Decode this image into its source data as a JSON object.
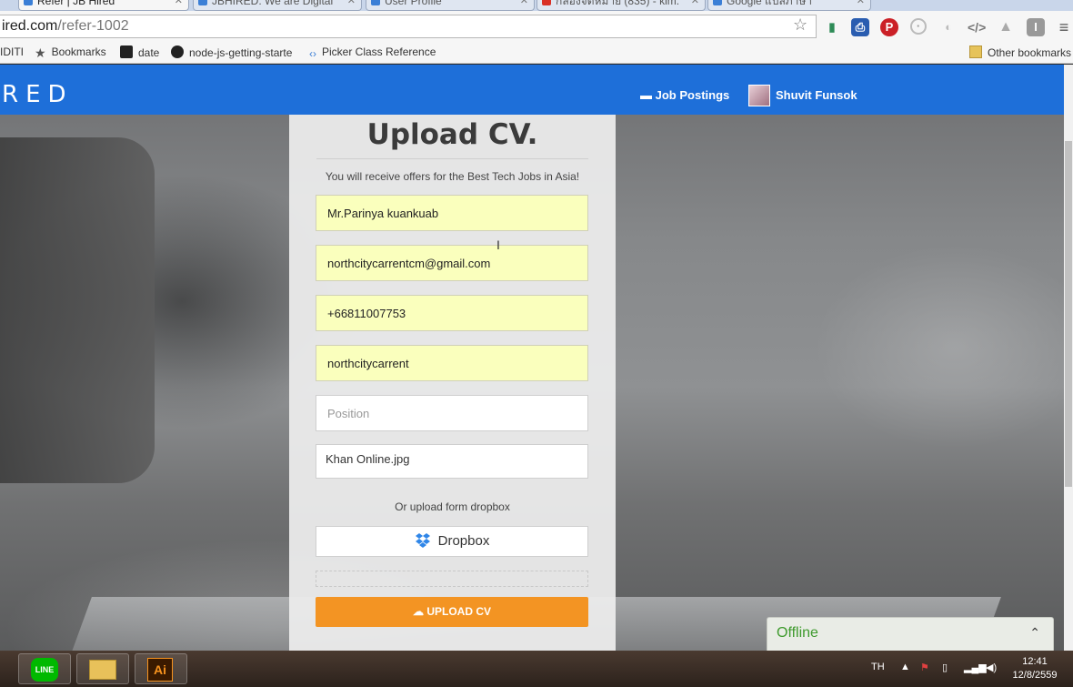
{
  "browser": {
    "tabs": [
      {
        "title": "Refer | JB Hired",
        "active": true
      },
      {
        "title": "JBHIRED: We are Digital",
        "active": false
      },
      {
        "title": "User Profile",
        "active": false
      },
      {
        "title": "กล่องจดหมาย (835) - kim.",
        "active": false
      },
      {
        "title": "Google แปลภาษา",
        "active": false
      }
    ],
    "url_host": "ired.com",
    "url_path": "/refer-1002",
    "bookmarks": [
      {
        "label": "ІDITI",
        "icon": "page-icon"
      },
      {
        "label": "Bookmarks",
        "icon": "star-icon"
      },
      {
        "label": "date",
        "icon": "page-icon"
      },
      {
        "label": "node-js-getting-starte",
        "icon": "github-icon"
      },
      {
        "label": "Picker Class Reference",
        "icon": "code-icon"
      }
    ],
    "other_bookmarks": "Other bookmarks"
  },
  "site": {
    "logo": "RED",
    "nav_job_postings": "Job Postings",
    "nav_user_name": "Shuvit Funsok"
  },
  "form": {
    "title": "Upload CV.",
    "subtitle": "You will receive offers for the Best Tech Jobs in Asia!",
    "name_value": "Mr.Parinya kuankuab",
    "email_value": "northcitycarrentcm@gmail.com",
    "phone_value": "+66811007753",
    "company_value": "northcitycarrent",
    "position_placeholder": "Position",
    "file_name": "Khan Online.jpg",
    "or_upload_text": "Or upload form dropbox",
    "dropbox_label": "Dropbox",
    "upload_button": "UPLOAD CV"
  },
  "chat": {
    "status": "Offline"
  },
  "taskbar": {
    "apps": [
      {
        "name": "LINE",
        "label": "LINE",
        "color": "#00b900"
      },
      {
        "name": "File Explorer",
        "label": "",
        "color": "#e8c15a"
      },
      {
        "name": "Adobe Illustrator",
        "label": "Ai",
        "color": "#f7931e"
      }
    ],
    "language": "TH",
    "time": "12:41",
    "date": "12/8/2559"
  }
}
